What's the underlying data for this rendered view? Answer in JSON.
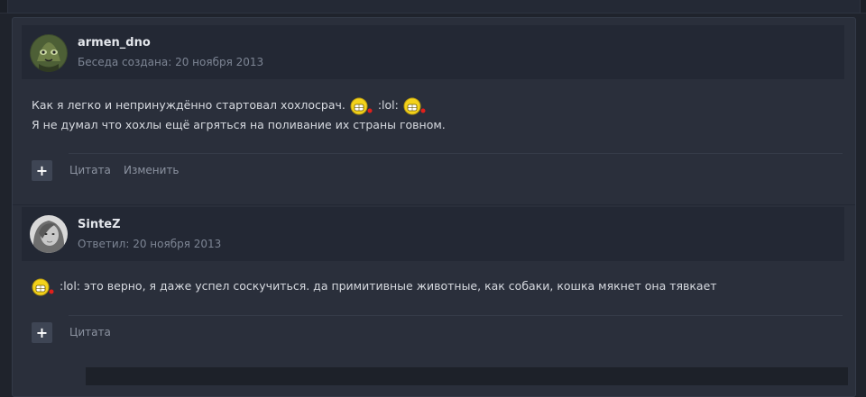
{
  "posts": [
    {
      "username": "armen_dno",
      "meta": "Беседа создана: 20 ноября 2013",
      "line1_text": "Как я легко и непринуждённо стартовал хохлосрач.",
      "line1_code": ":lol:",
      "line2_text": "Я не думал что хохлы ещё агряться на поливание их страны говном.",
      "quote_label": "Цитата",
      "edit_label": "Изменить"
    },
    {
      "username": "SinteZ",
      "meta": "Ответил: 20 ноября 2013",
      "line1_code": ":lol:",
      "line1_text": "это верно, я даже успел соскучиться. да примитивные животные, как собаки, кошка мякнет она тявкает",
      "quote_label": "Цитата"
    }
  ],
  "icons": {
    "add": "+",
    "smiley": "laughing-smiley-icon"
  },
  "colors": {
    "background": "#1f232c",
    "panel": "#2a2f3b",
    "header": "#232834",
    "username": "#e4e7ec",
    "meta": "#7d8594",
    "smiley_yellow": "#f3d21b",
    "smiley_red": "#e0201b"
  }
}
